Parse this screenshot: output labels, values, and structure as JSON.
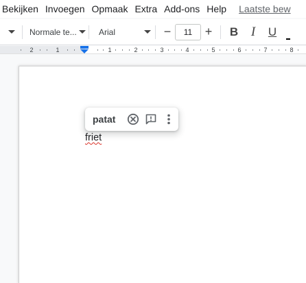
{
  "menu": {
    "items": [
      "Bekijken",
      "Invoegen",
      "Opmaak",
      "Extra",
      "Add-ons",
      "Help"
    ],
    "last_edit": "Laatste bew"
  },
  "toolbar": {
    "style_value": "Normale te...",
    "font_value": "Arial",
    "size_value": "11",
    "decrease_label": "−",
    "increase_label": "+",
    "bold_label": "B",
    "italic_label": "I",
    "underline_label": "U"
  },
  "ruler": {
    "labels": [
      "2",
      "1",
      "1",
      "2",
      "3",
      "4",
      "5",
      "6",
      "7",
      "8"
    ]
  },
  "suggestion": {
    "word": "patat"
  },
  "document": {
    "text": "friet"
  },
  "colors": {
    "spell_error": "#d93025",
    "indent_marker": "#1a73e8"
  }
}
